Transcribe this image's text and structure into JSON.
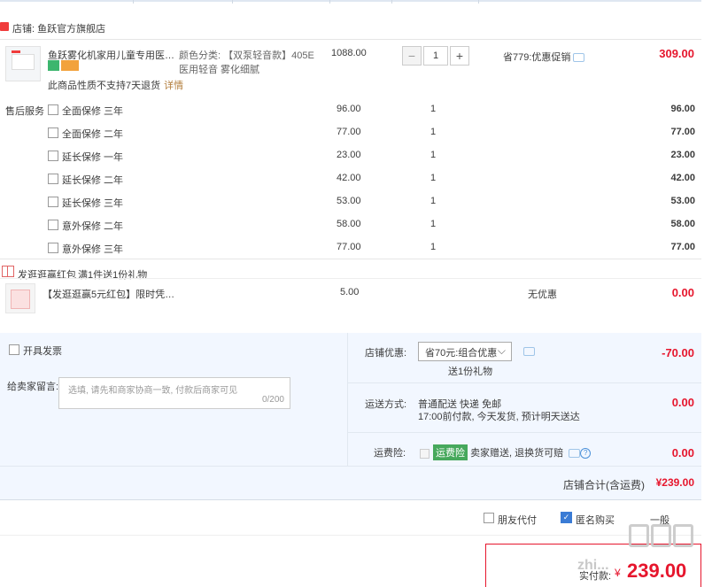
{
  "store": {
    "name": "店铺: 鱼跃官方旗舰店"
  },
  "product": {
    "title": "鱼跃雾化机家用儿童专用医用化...",
    "attr_line1": "颜色分类: 【双泵轻音款】405E",
    "attr_line2": "医用轻音 雾化细腻",
    "price": "1088.00",
    "qty": "1",
    "promo": "省779:优惠促销",
    "total": "309.00",
    "policy": "此商品性质不支持7天退货",
    "policy_link": "详情"
  },
  "service": {
    "label": "售后服务",
    "items": [
      {
        "name": "全面保修 三年",
        "price": "96.00",
        "qty": "1",
        "total": "96.00"
      },
      {
        "name": "全面保修 二年",
        "price": "77.00",
        "qty": "1",
        "total": "77.00"
      },
      {
        "name": "延长保修 一年",
        "price": "23.00",
        "qty": "1",
        "total": "23.00"
      },
      {
        "name": "延长保修 二年",
        "price": "42.00",
        "qty": "1",
        "total": "42.00"
      },
      {
        "name": "延长保修 三年",
        "price": "53.00",
        "qty": "1",
        "total": "53.00"
      },
      {
        "name": "意外保修 二年",
        "price": "58.00",
        "qty": "1",
        "total": "58.00"
      },
      {
        "name": "意外保修 三年",
        "price": "77.00",
        "qty": "1",
        "total": "77.00"
      }
    ]
  },
  "gift": {
    "title": "发逛逛赢红包",
    "subtitle": "满1件送1份礼物",
    "name": "【发逛逛赢5元红包】限时凭证-...",
    "price": "5.00",
    "promo": "无优惠",
    "total": "0.00"
  },
  "invoice": {
    "label": "开具发票"
  },
  "message": {
    "label": "给卖家留言:",
    "placeholder": "选填, 请先和商家协商一致, 付款后商家可见",
    "counter": "0/200"
  },
  "store_discount": {
    "label": "店铺优惠:",
    "selected": "省70元:组合优惠",
    "note": "送1份礼物",
    "amount": "-70.00"
  },
  "shipping": {
    "label": "运送方式:",
    "line1": "普通配送 快递 免邮",
    "line2": "17:00前付款, 今天发货, 预计明天送达",
    "amount": "0.00"
  },
  "insurance": {
    "label": "运费险:",
    "tag": "运费险",
    "text": "卖家赠送, 退换货可赔",
    "q": "?",
    "amount": "0.00"
  },
  "store_total": {
    "label": "店铺合计(含运费)",
    "amount": "¥239.00"
  },
  "options": {
    "friend_pay": "朋友代付",
    "anonymous": "匿名购买",
    "one_item": "一般"
  },
  "pay": {
    "label": "实付款:",
    "currency": "¥",
    "amount": "239.00"
  },
  "watermark": {
    "text": "zhi..."
  },
  "colors": {
    "red": "#e6162d",
    "panel": "#f2f7ff",
    "blue": "#3a7bd5",
    "green": "#46a85c"
  }
}
